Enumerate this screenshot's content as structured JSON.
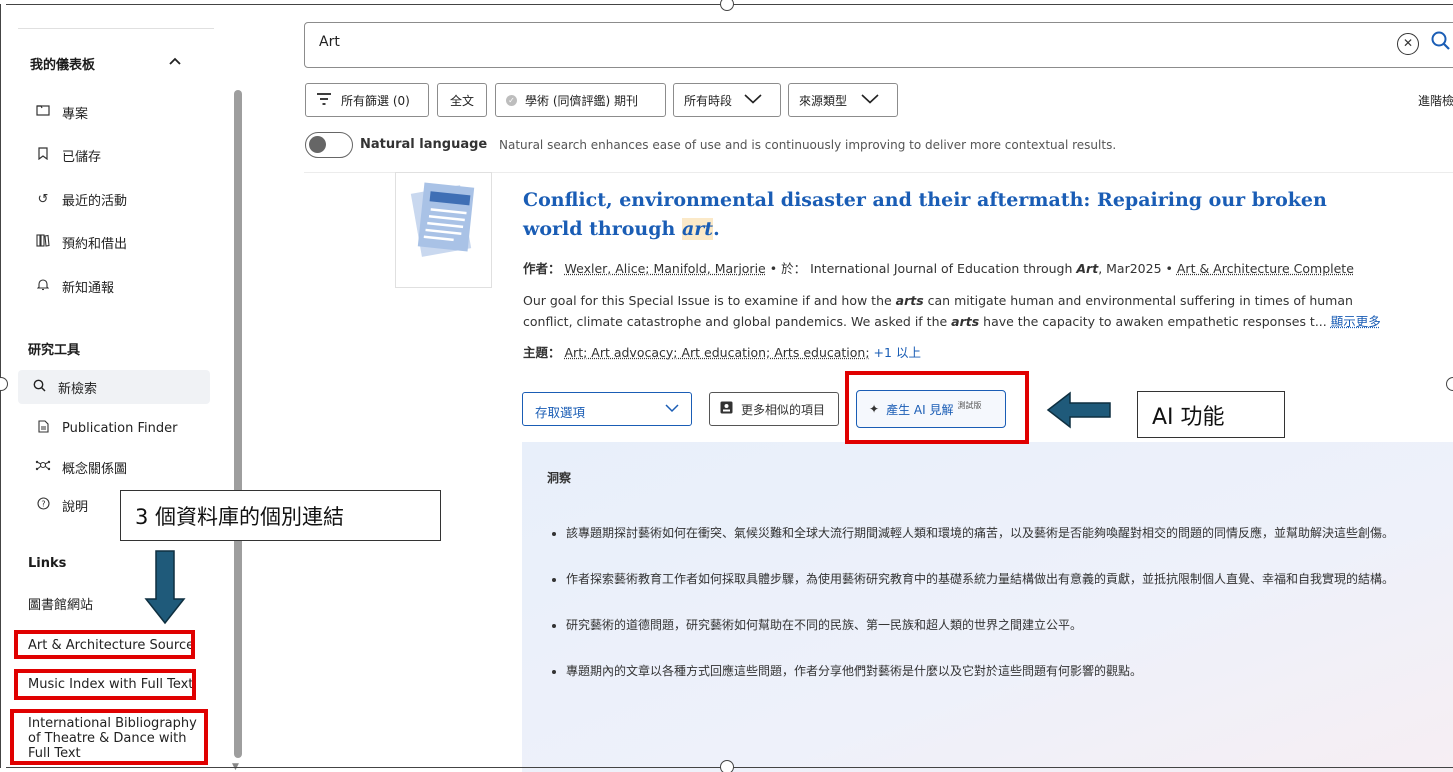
{
  "sidebar": {
    "dashboard_heading": "我的儀表板",
    "dashboard_items": [
      {
        "icon": "folder-icon",
        "label": "專案"
      },
      {
        "icon": "bookmark-icon",
        "label": "已儲存"
      },
      {
        "icon": "history-icon",
        "label": "最近的活動"
      },
      {
        "icon": "books-icon",
        "label": "預約和借出"
      },
      {
        "icon": "bell-icon",
        "label": "新知通報"
      }
    ],
    "tools_heading": "研究工具",
    "tools_items": [
      {
        "icon": "search-icon",
        "label": "新檢索"
      },
      {
        "icon": "document-icon",
        "label": "Publication Finder"
      },
      {
        "icon": "concept-map-icon",
        "label": "概念關係圖"
      },
      {
        "icon": "help-icon",
        "label": "說明"
      }
    ],
    "links_heading": "Links",
    "links": [
      "圖書館網站",
      "Art & Architecture Source",
      "Music Index with Full Text",
      "International Bibliography of Theatre & Dance with Full Text"
    ]
  },
  "search": {
    "query": "Art"
  },
  "filters": {
    "all_filters": "所有篩選 (0)",
    "full_text": "全文",
    "peer_reviewed": "學術 (同儕評鑑) 期刊",
    "all_time": "所有時段",
    "source_type": "來源類型",
    "advanced": "進階檢"
  },
  "natural_language": {
    "label": "Natural language",
    "description": "Natural search enhances ease of use and is continuously improving to deliver more contextual results.",
    "enabled": false
  },
  "result": {
    "title_main": "Conflict, environmental disaster and their aftermath: Repairing our broken world through ",
    "title_highlight": "art",
    "title_end": ".",
    "author_label": "作者：",
    "authors": "Wexler, Alice; Manifold, Marjorie",
    "in_label": "• 於：",
    "source_pre": "International Journal of Education through ",
    "source_hl": "Art",
    "source_post": ", Mar2025 •",
    "database": "Art & Architecture Complete",
    "abstract_1": "Our goal for this Special Issue is to examine if and how the ",
    "abstract_hl1": "arts",
    "abstract_2": " can mitigate human and environmental suffering in times of human conflict, climate catastrophe and global pandemics. We asked if the ",
    "abstract_hl2": "arts",
    "abstract_3": " have the capacity to awaken empathetic responses t... ",
    "show_more": "顯示更多",
    "subjects_label": "主題：",
    "subjects": "Art; Art advocacy; Art education; Arts education;",
    "subjects_more": "+1 以上",
    "access_select": "存取選項",
    "similar_button": "更多相似的項目",
    "ai_button": "產生 AI 見解",
    "ai_beta": "測試版"
  },
  "insight": {
    "title": "洞察",
    "bullets": [
      "該專題期探討藝術如何在衝突、氣候災難和全球大流行期間減輕人類和環境的痛苦，以及藝術是否能夠喚醒對相交的問題的同情反應，並幫助解決這些創傷。",
      "作者探索藝術教育工作者如何採取具體步驟，為使用藝術研究教育中的基礎系統力量結構做出有意義的貢獻，並抵抗限制個人直覺、幸福和自我實現的結構。",
      "研究藝術的道德問題，研究藝術如何幫助在不同的民族、第一民族和超人類的世界之間建立公平。",
      "專題期內的文章以各種方式回應這些問題，作者分享他們對藝術是什麼以及它對於這些問題有何影響的觀點。"
    ]
  },
  "annotations": {
    "ai_note": "AI 功能",
    "links_note": "3 個資料庫的個別連結",
    "highlight_color": "#e00000",
    "arrow_color": "#1f5a7a"
  }
}
